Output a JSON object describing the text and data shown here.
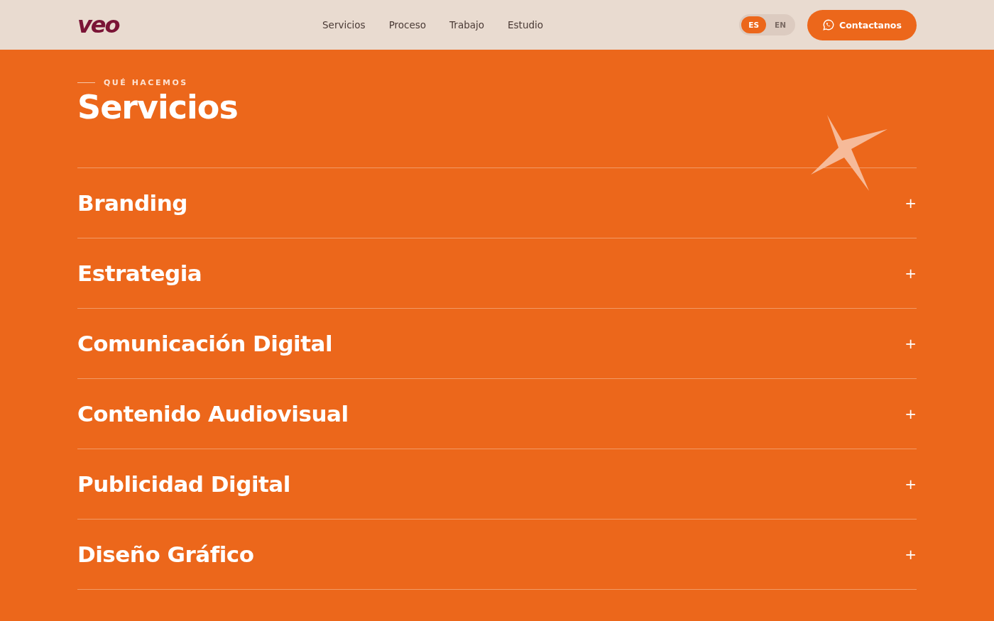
{
  "header": {
    "logo": "veo",
    "nav": [
      {
        "label": "Servicios"
      },
      {
        "label": "Proceso"
      },
      {
        "label": "Trabajo"
      },
      {
        "label": "Estudio"
      }
    ],
    "languages": [
      {
        "label": "ES",
        "selected": true
      },
      {
        "label": "EN",
        "selected": false
      }
    ],
    "contact_button": "Contactanos"
  },
  "section": {
    "eyebrow": "QUÉ HACEMOS",
    "title": "Servicios",
    "services": [
      {
        "name": "Branding",
        "expanded": false,
        "toggle": "+"
      },
      {
        "name": "Estrategia",
        "expanded": false,
        "toggle": "+"
      },
      {
        "name": "Comunicación Digital",
        "expanded": false,
        "toggle": "+"
      },
      {
        "name": "Contenido Audiovisual",
        "expanded": false,
        "toggle": "+"
      },
      {
        "name": "Publicidad Digital",
        "expanded": false,
        "toggle": "+"
      },
      {
        "name": "Diseño Gráfico",
        "expanded": false,
        "toggle": "+"
      }
    ]
  }
}
